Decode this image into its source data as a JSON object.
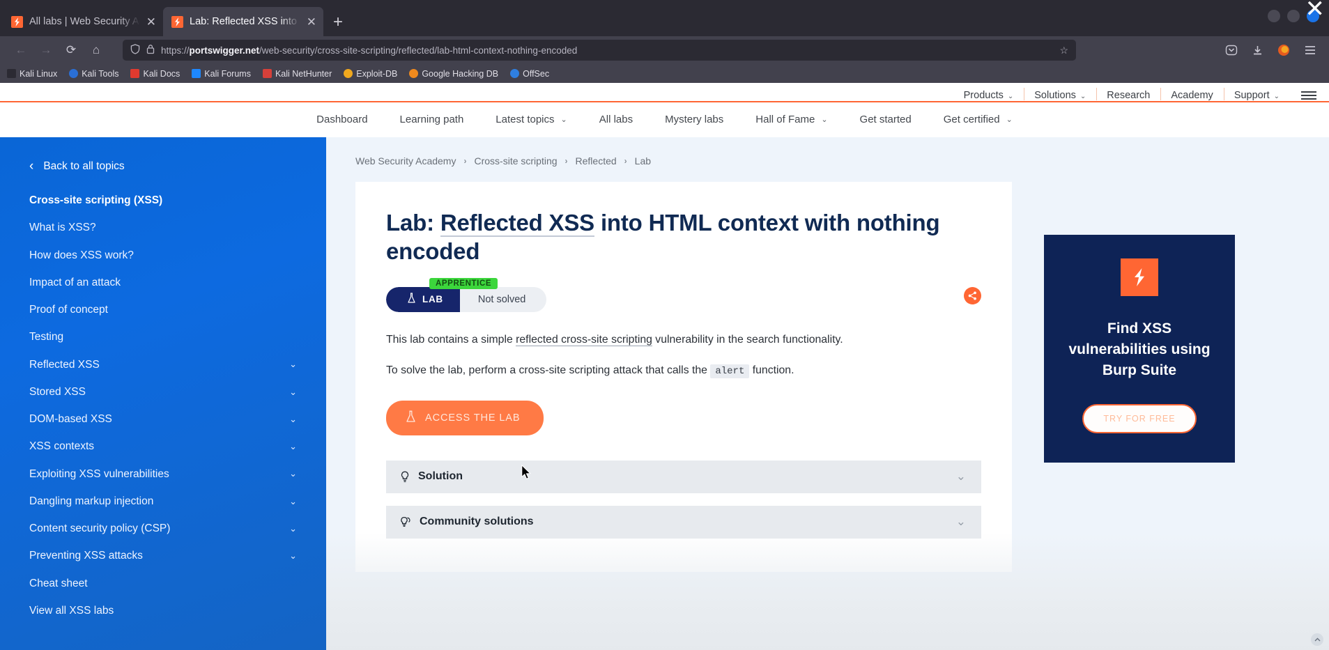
{
  "browser": {
    "tabs": [
      {
        "title": "All labs | Web Security Ac",
        "active": false,
        "close": "✕"
      },
      {
        "title": "Lab: Reflected XSS into H",
        "active": true,
        "close": "✕"
      }
    ],
    "newtab_label": "+",
    "window_close_label": "✕",
    "nav": {
      "back": "←",
      "forward": "→",
      "reload": "⟳",
      "home": "⌂"
    },
    "url": {
      "full": "https://portswigger.net/web-security/cross-site-scripting/reflected/lab-html-context-nothing-encoded",
      "domain": "portswigger.net",
      "prefix": "https://",
      "path": "/web-security/cross-site-scripting/reflected/lab-html-context-nothing-encoded",
      "shield_icon": "shield-icon",
      "lock_icon": "lock-icon",
      "bookmark_star": "☆"
    },
    "toolbar_right": [
      {
        "name": "pocket-icon",
        "glyph": "⮚"
      },
      {
        "name": "downloads-icon",
        "glyph": "⬇"
      },
      {
        "name": "firefox-account-icon",
        "glyph": "●"
      },
      {
        "name": "app-menu-icon",
        "glyph": "☰"
      }
    ],
    "bookmarks": [
      {
        "label": "Kali Linux",
        "color": "#2b2a33"
      },
      {
        "label": "Kali Tools",
        "color": "#2a6fd6"
      },
      {
        "label": "Kali Docs",
        "color": "#e03a2f"
      },
      {
        "label": "Kali Forums",
        "color": "#1e88ff"
      },
      {
        "label": "Kali NetHunter",
        "color": "#d6403a"
      },
      {
        "label": "Exploit-DB",
        "color": "#f0a81e"
      },
      {
        "label": "Google Hacking DB",
        "color": "#f08a1e"
      },
      {
        "label": "OffSec",
        "color": "#2f7fe0"
      }
    ]
  },
  "site_top_nav": {
    "items": [
      {
        "label": "Products",
        "caret": "⌄"
      },
      {
        "label": "Solutions",
        "caret": "⌄"
      },
      {
        "label": "Research",
        "caret": ""
      },
      {
        "label": "Academy",
        "caret": ""
      },
      {
        "label": "Support",
        "caret": "⌄"
      }
    ]
  },
  "academy_nav": {
    "items": [
      {
        "label": "Dashboard",
        "caret": ""
      },
      {
        "label": "Learning path",
        "caret": ""
      },
      {
        "label": "Latest topics",
        "caret": "⌄"
      },
      {
        "label": "All labs",
        "caret": ""
      },
      {
        "label": "Mystery labs",
        "caret": ""
      },
      {
        "label": "Hall of Fame",
        "caret": "⌄"
      },
      {
        "label": "Get started",
        "caret": ""
      },
      {
        "label": "Get certified",
        "caret": "⌄"
      }
    ]
  },
  "sidebar": {
    "back_label": "Back to all topics",
    "back_chevron": "‹",
    "items": [
      {
        "label": "Cross-site scripting (XSS)",
        "current": true,
        "expandable": false
      },
      {
        "label": "What is XSS?",
        "current": false,
        "expandable": false
      },
      {
        "label": "How does XSS work?",
        "current": false,
        "expandable": false
      },
      {
        "label": "Impact of an attack",
        "current": false,
        "expandable": false
      },
      {
        "label": "Proof of concept",
        "current": false,
        "expandable": false
      },
      {
        "label": "Testing",
        "current": false,
        "expandable": false
      },
      {
        "label": "Reflected XSS",
        "current": false,
        "expandable": true
      },
      {
        "label": "Stored XSS",
        "current": false,
        "expandable": true
      },
      {
        "label": "DOM-based XSS",
        "current": false,
        "expandable": true
      },
      {
        "label": "XSS contexts",
        "current": false,
        "expandable": true
      },
      {
        "label": "Exploiting XSS vulnerabilities",
        "current": false,
        "expandable": true
      },
      {
        "label": "Dangling markup injection",
        "current": false,
        "expandable": true
      },
      {
        "label": "Content security policy (CSP)",
        "current": false,
        "expandable": true
      },
      {
        "label": "Preventing XSS attacks",
        "current": false,
        "expandable": true
      },
      {
        "label": "Cheat sheet",
        "current": false,
        "expandable": false
      },
      {
        "label": "View all XSS labs",
        "current": false,
        "expandable": false
      }
    ],
    "expand_chevron": "⌄"
  },
  "breadcrumb": {
    "items": [
      "Web Security Academy",
      "Cross-site scripting",
      "Reflected",
      "Lab"
    ],
    "separator": "›"
  },
  "lab": {
    "title_prefix": "Lab: ",
    "title_underlined": "Reflected XSS",
    "title_rest": " into HTML context with nothing encoded",
    "title_full": "Lab: Reflected XSS into HTML context with nothing encoded",
    "difficulty_badge": "APPRENTICE",
    "pill_left_label": "LAB",
    "pill_right_label": "Not solved",
    "flask_icon": "flask-icon",
    "share_icon": "share-icon",
    "description_1_a": "This lab contains a simple ",
    "description_1_link": "reflected cross-site scripting",
    "description_1_b": " vulnerability in the search functionality.",
    "description_2_a": "To solve the lab, perform a cross-site scripting attack that calls the ",
    "description_2_code": "alert",
    "description_2_b": " function.",
    "access_button_label": "ACCESS THE LAB",
    "accordion": [
      {
        "label": "Solution",
        "icon": "lightbulb-icon",
        "chevron": "⌄"
      },
      {
        "label": "Community solutions",
        "icon": "lightbulb-group-icon",
        "chevron": "⌄"
      }
    ]
  },
  "promo": {
    "logo_icon": "burp-suite-logo",
    "headline": "Find XSS vulnerabilities using Burp Suite",
    "cta_label": "TRY FOR FREE"
  },
  "colors": {
    "accent_orange": "#ff6633",
    "sidebar_blue": "#0d6ae0",
    "navy": "#102a53",
    "apprentice_green": "#3cd63c",
    "promo_navy": "#0e2356"
  }
}
